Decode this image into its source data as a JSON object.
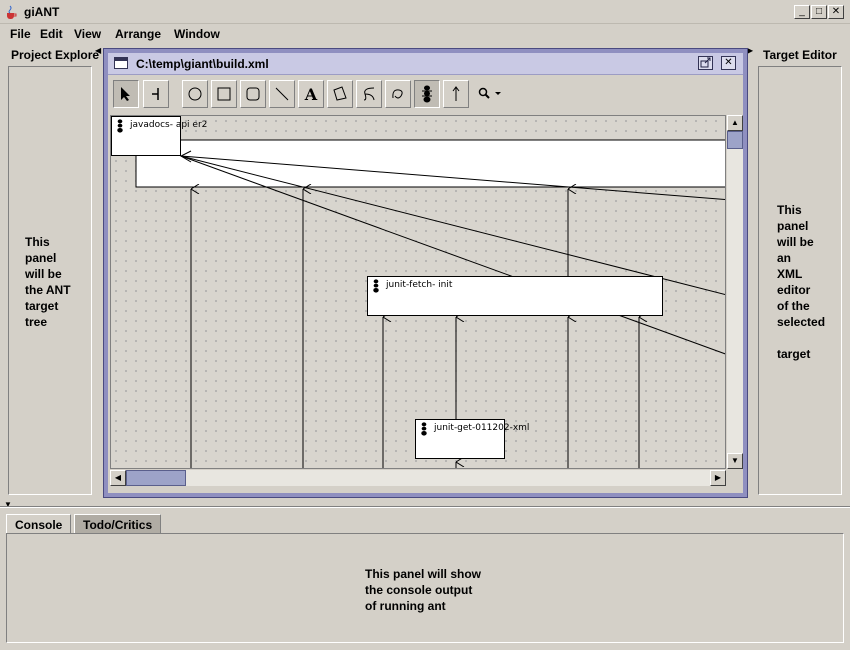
{
  "window": {
    "title": "giANT"
  },
  "menu": [
    "File",
    "Edit",
    "View",
    "Arrange",
    "Window"
  ],
  "left_panel": {
    "title": "Project Explore",
    "text": "This\npanel\nwill be\nthe ANT\ntarget\ntree"
  },
  "right_panel": {
    "title": "Target Editor",
    "text": "This\npanel\nwill be\nan\nXML\neditor\nof the\nselected\n\ntarget"
  },
  "editor": {
    "title": "C:\\temp\\giant\\build.xml"
  },
  "toolbar": {
    "tools": [
      "select-tool",
      "connector-tool",
      "ellipse-tool",
      "rectangle-tool",
      "rounded-rect-tool",
      "line-tool",
      "text-tool",
      "polygon-tool",
      "curve-tool",
      "spline-tool",
      "ant-target-tool",
      "arrow-tool",
      "zoom-tool"
    ],
    "text_tool_glyph": "A"
  },
  "diagram": {
    "nodes": [
      {
        "id": "javadocs",
        "label": "javadocs- api er2"
      },
      {
        "id": "junit-fetch-init",
        "label": "junit-fetch- init"
      },
      {
        "id": "junit-get",
        "label": "junit-get-011202-xml"
      }
    ]
  },
  "tabs": [
    {
      "label": "Console",
      "active": true
    },
    {
      "label": "Todo/Critics",
      "active": false
    }
  ],
  "console": {
    "text": "This panel will show\nthe console output\nof running ant"
  }
}
